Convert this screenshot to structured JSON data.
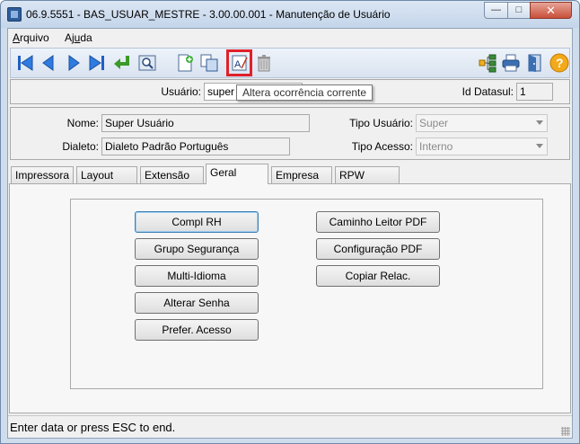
{
  "window": {
    "title": "06.9.5551 - BAS_USUAR_MESTRE - 3.00.00.001 - Manutenção de Usuário"
  },
  "menu": {
    "arquivo_first": "A",
    "arquivo_rest": "rquivo",
    "ajuda_pre": "Aj",
    "ajuda_u": "u",
    "ajuda_rest": "da"
  },
  "toolbar": {
    "icons": [
      "first-icon",
      "prev-icon",
      "next-icon",
      "last-icon",
      "goto-icon",
      "search-icon",
      "new-icon",
      "copy-icon",
      "edit-icon",
      "delete-icon",
      "tree-icon",
      "print-icon",
      "exit-icon",
      "help-icon"
    ],
    "tooltip": "Altera ocorrência corrente",
    "highlight_color": "#e0202a"
  },
  "header": {
    "usuario_label": "Usuário:",
    "usuario_value": "super",
    "id_datasul_label": "Id Datasul:",
    "id_datasul_value": "1"
  },
  "details": {
    "nome_label": "Nome:",
    "nome_value": "Super Usuário",
    "dialeto_label": "Dialeto:",
    "dialeto_value": "Dialeto Padrão Português",
    "tipo_usuario_label": "Tipo Usuário:",
    "tipo_usuario_value": "Super",
    "tipo_acesso_label": "Tipo Acesso:",
    "tipo_acesso_value": "Interno"
  },
  "tabs": [
    "Impressora",
    "Layout",
    "Extensão",
    "Geral",
    "Empresa",
    "RPW"
  ],
  "active_tab": "Geral",
  "buttons_left": [
    "Compl RH",
    "Grupo Segurança",
    "Multi-Idioma",
    "Alterar Senha",
    "Prefer. Acesso"
  ],
  "buttons_right": [
    "Caminho Leitor PDF",
    "Configuração PDF",
    "Copiar Relac."
  ],
  "status": {
    "text": "Enter data or press ESC to end."
  }
}
